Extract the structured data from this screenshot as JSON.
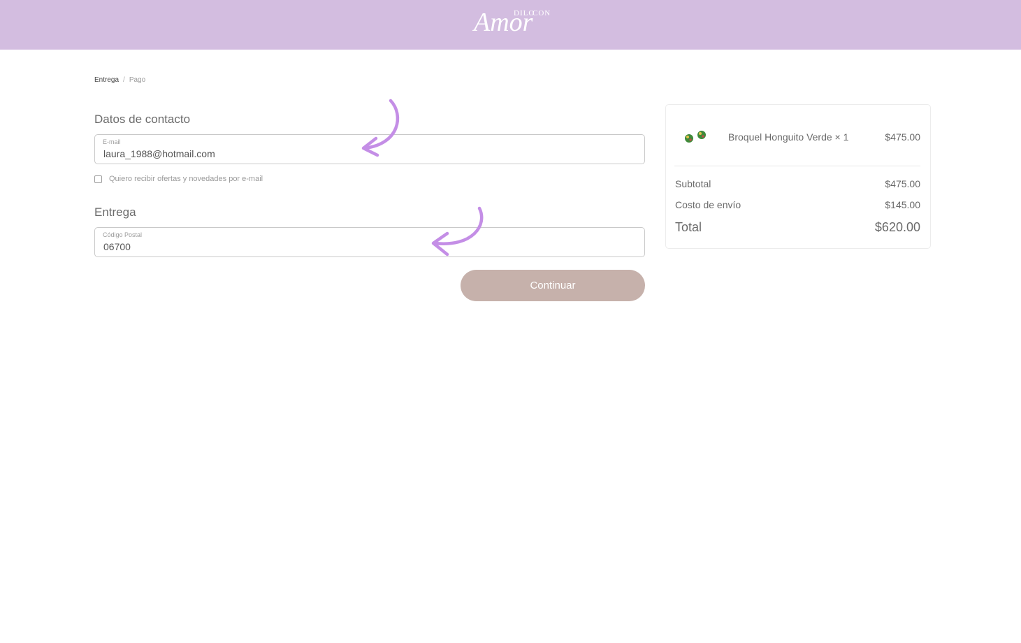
{
  "header": {
    "logo": {
      "words": [
        "DILO",
        "CON",
        "Amor"
      ],
      "icon": "brand-logo",
      "color": "#ffffff"
    },
    "background": "#d3bde0"
  },
  "breadcrumb": {
    "items": [
      {
        "label": "Entrega",
        "active": true
      },
      {
        "label": "Pago",
        "active": false
      }
    ],
    "separator": "/"
  },
  "contact": {
    "title": "Datos de contacto",
    "email": {
      "label": "E-mail",
      "value": "laura_1988@hotmail.com"
    },
    "newsletter": {
      "label": "Quiero recibir ofertas y novedades por e-mail",
      "checked": false
    }
  },
  "delivery": {
    "title": "Entrega",
    "postal": {
      "label": "Código Postal",
      "value": "06700"
    }
  },
  "actions": {
    "continue_label": "Continuar",
    "button_color": "#c6b1ab"
  },
  "annotations": {
    "arrow_color": "#c48ee6",
    "icon": "curved-arrow-icon"
  },
  "summary": {
    "item": {
      "name": "Broquel Honguito Verde × 1",
      "price": "$475.00",
      "icon": "earrings-thumbnail"
    },
    "subtotal": {
      "label": "Subtotal",
      "value": "$475.00"
    },
    "shipping": {
      "label": "Costo de envío",
      "value": "$145.00"
    },
    "total": {
      "label": "Total",
      "value": "$620.00"
    }
  }
}
